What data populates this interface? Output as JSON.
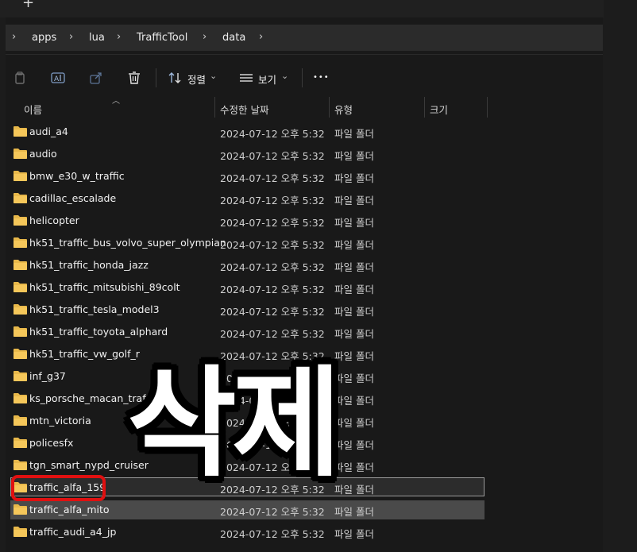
{
  "tab_bar": {
    "new_tab_glyph": "+"
  },
  "breadcrumb": {
    "chevron": "›",
    "items": [
      "apps",
      "lua",
      "TrafficTool",
      "data"
    ]
  },
  "toolbar": {
    "icons": [
      "copy-icon",
      "rename-icon",
      "share-icon",
      "delete-icon"
    ],
    "sort_label": "정렬",
    "view_label": "보기",
    "more_glyph": "•••",
    "dropdown_glyph": "⌄"
  },
  "columns": {
    "name": "이름",
    "modified": "수정한 날짜",
    "type": "유형",
    "size": "크기"
  },
  "folder_color": "#e8b84a",
  "files": [
    {
      "name": "audi_a4",
      "date": "2024-07-12 오후 5:32",
      "type": "파일 폴더"
    },
    {
      "name": "audio",
      "date": "2024-07-12 오후 5:32",
      "type": "파일 폴더"
    },
    {
      "name": "bmw_e30_w_traffic",
      "date": "2024-07-12 오후 5:32",
      "type": "파일 폴더"
    },
    {
      "name": "cadillac_escalade",
      "date": "2024-07-12 오후 5:32",
      "type": "파일 폴더"
    },
    {
      "name": "helicopter",
      "date": "2024-07-12 오후 5:32",
      "type": "파일 폴더"
    },
    {
      "name": "hk51_traffic_bus_volvo_super_olympian",
      "date": "2024-07-12 오후 5:32",
      "type": "파일 폴더"
    },
    {
      "name": "hk51_traffic_honda_jazz",
      "date": "2024-07-12 오후 5:32",
      "type": "파일 폴더"
    },
    {
      "name": "hk51_traffic_mitsubishi_89colt",
      "date": "2024-07-12 오후 5:32",
      "type": "파일 폴더"
    },
    {
      "name": "hk51_traffic_tesla_model3",
      "date": "2024-07-12 오후 5:32",
      "type": "파일 폴더"
    },
    {
      "name": "hk51_traffic_toyota_alphard",
      "date": "2024-07-12 오후 5:32",
      "type": "파일 폴더"
    },
    {
      "name": "hk51_traffic_vw_golf_r",
      "date": "2024-07-12 오후 5:32",
      "type": "파일 폴더"
    },
    {
      "name": "inf_g37",
      "date": "2024-07-12 오후 5:32",
      "type": "파일 폴더"
    },
    {
      "name": "ks_porsche_macan_traffic",
      "date": "2024-07-12 오후 5:32",
      "type": "파일 폴더"
    },
    {
      "name": "mtn_victoria",
      "date": "2024-07-12 오후 5:32",
      "type": "파일 폴더"
    },
    {
      "name": "policesfx",
      "date": "2024-07-12 오후 5:32",
      "type": "파일 폴더"
    },
    {
      "name": "tgn_smart_nypd_cruiser",
      "date": "2024-07-12 오후 5:32",
      "type": "파일 폴더"
    },
    {
      "name": "traffic_alfa_159",
      "date": "2024-07-12 오후 5:32",
      "type": "파일 폴더"
    },
    {
      "name": "traffic_alfa_mito",
      "date": "2024-07-12 오후 5:32",
      "type": "파일 폴더"
    },
    {
      "name": "traffic_audi_a4_jp",
      "date": "2024-07-12 오후 5:32",
      "type": "파일 폴더"
    }
  ],
  "overlay": {
    "text": "삭제",
    "annotation_color": "#e01010"
  }
}
